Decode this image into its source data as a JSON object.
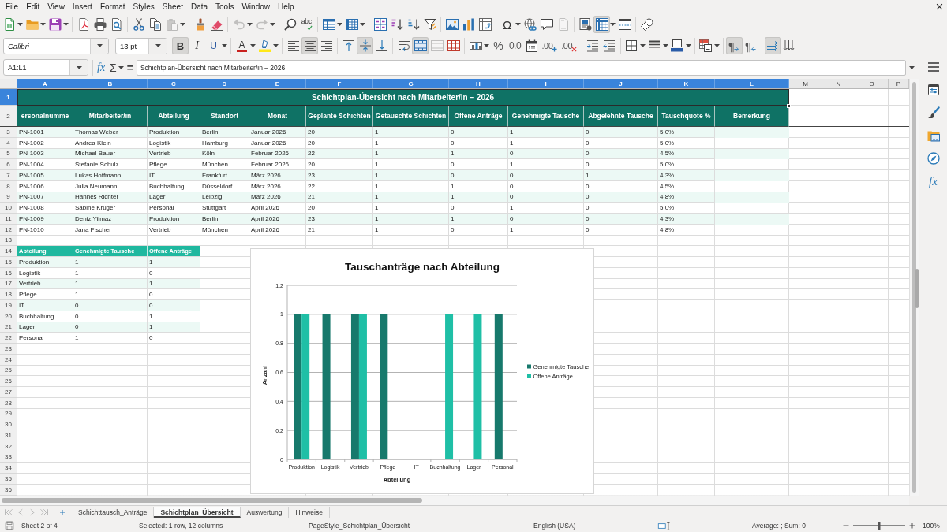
{
  "menu_bar": [
    "File",
    "Edit",
    "View",
    "Insert",
    "Format",
    "Styles",
    "Sheet",
    "Data",
    "Tools",
    "Window",
    "Help"
  ],
  "standard_toolbar": {
    "paste": {
      "disabled": true
    },
    "undo": {
      "disabled": true
    },
    "redo": {
      "disabled": true
    },
    "spelling": {
      "label": "abc"
    },
    "special_character": {
      "label": "Ω"
    },
    "header_footer": {
      "disabled": true
    },
    "freeze": {
      "selected": true
    }
  },
  "formatting_toolbar": {
    "font_name": "Calibri",
    "font_size": "13 pt",
    "bold": {
      "label": "B",
      "selected": true
    },
    "italic": {
      "label": "I",
      "selected": false
    },
    "underline": {
      "label": "U",
      "selected": false
    },
    "font_color": {
      "label": "A"
    },
    "horizontal_align": [
      {
        "selected": false
      },
      {
        "selected": true
      },
      {
        "selected": false
      }
    ],
    "vertical_align": [
      {
        "selected": false
      },
      {
        "selected": true
      },
      {
        "selected": false
      }
    ],
    "merge_and_center": {
      "selected": true
    },
    "merge_cells": {
      "disabled": true
    },
    "percent": {
      "label": "%"
    },
    "number": {
      "label": "0.0"
    },
    "add_decimal": {
      "label": ".00"
    },
    "delete_decimal": {
      "label": ".00"
    },
    "left_to_right": {
      "label": "¶",
      "selected": true
    },
    "right_to_left": {
      "label": "¶",
      "selected": false
    },
    "text_direction": [
      {
        "selected": true
      },
      {
        "selected": false
      }
    ]
  },
  "formula_bar": {
    "name_box": "A1:L1",
    "function_wizard": "fx",
    "sum": "Σ",
    "formula": "=",
    "content": "Schichtplan-Übersicht nach Mitarbeiter/in – 2026"
  },
  "sidebar": {
    "functions": "fx"
  },
  "columns": [
    {
      "label": "A",
      "selected": true
    },
    {
      "label": "B",
      "selected": true
    },
    {
      "label": "C",
      "selected": true
    },
    {
      "label": "D",
      "selected": true
    },
    {
      "label": "E",
      "selected": true
    },
    {
      "label": "F",
      "selected": true
    },
    {
      "label": "G",
      "selected": true
    },
    {
      "label": "H",
      "selected": true
    },
    {
      "label": "I",
      "selected": true
    },
    {
      "label": "J",
      "selected": true
    },
    {
      "label": "K",
      "selected": true
    },
    {
      "label": "L",
      "selected": true
    },
    {
      "label": "M",
      "selected": false
    },
    {
      "label": "N",
      "selected": false
    },
    {
      "label": "O",
      "selected": false
    },
    {
      "label": "P",
      "selected": false
    }
  ],
  "rows": [
    {
      "label": "1",
      "selected": true
    },
    {
      "label": "2",
      "selected": false
    },
    {
      "label": "3",
      "selected": false
    },
    {
      "label": "4",
      "selected": false
    },
    {
      "label": "5",
      "selected": false
    },
    {
      "label": "6",
      "selected": false
    },
    {
      "label": "7",
      "selected": false
    },
    {
      "label": "8",
      "selected": false
    },
    {
      "label": "9",
      "selected": false
    },
    {
      "label": "10",
      "selected": false
    },
    {
      "label": "11",
      "selected": false
    },
    {
      "label": "12",
      "selected": false
    },
    {
      "label": "13",
      "selected": false
    },
    {
      "label": "14",
      "selected": false
    },
    {
      "label": "15",
      "selected": false
    },
    {
      "label": "16",
      "selected": false
    },
    {
      "label": "17",
      "selected": false
    },
    {
      "label": "18",
      "selected": false
    },
    {
      "label": "19",
      "selected": false
    },
    {
      "label": "20",
      "selected": false
    },
    {
      "label": "21",
      "selected": false
    },
    {
      "label": "22",
      "selected": false
    },
    {
      "label": "23",
      "selected": false
    },
    {
      "label": "24",
      "selected": false
    },
    {
      "label": "25",
      "selected": false
    },
    {
      "label": "26",
      "selected": false
    },
    {
      "label": "27",
      "selected": false
    },
    {
      "label": "28",
      "selected": false
    },
    {
      "label": "29",
      "selected": false
    },
    {
      "label": "30",
      "selected": false
    },
    {
      "label": "31",
      "selected": false
    },
    {
      "label": "32",
      "selected": false
    },
    {
      "label": "33",
      "selected": false
    },
    {
      "label": "34",
      "selected": false
    },
    {
      "label": "35",
      "selected": false
    },
    {
      "label": "36",
      "selected": false
    }
  ],
  "title": "Schichtplan-Übersicht nach Mitarbeiter/in – 2026",
  "table": {
    "headers": [
      "ersonalnumme",
      "Mitarbeiter/in",
      "Abteilung",
      "Standort",
      "Monat",
      "Geplante Schichten",
      "Getauschte Schichten",
      "Offene Anträge",
      "Genehmigte Tausche",
      "Abgelehnte Tausche",
      "Tauschquote %",
      "Bemerkung"
    ],
    "rows": [
      [
        "PN-1001",
        "Thomas Weber",
        "Produktion",
        "Berlin",
        "Januar 2026",
        "20",
        "1",
        "0",
        "1",
        "0",
        "5.0%"
      ],
      [
        "PN-1002",
        "Andrea Klein",
        "Logistik",
        "Hamburg",
        "Januar 2026",
        "20",
        "1",
        "0",
        "1",
        "0",
        "5.0%"
      ],
      [
        "PN-1003",
        "Michael Bauer",
        "Vertrieb",
        "Köln",
        "Februar 2026",
        "22",
        "1",
        "1",
        "0",
        "0",
        "4.5%"
      ],
      [
        "PN-1004",
        "Stefanie Schulz",
        "Pflege",
        "München",
        "Februar 2026",
        "20",
        "1",
        "0",
        "1",
        "0",
        "5.0%"
      ],
      [
        "PN-1005",
        "Lukas Hoffmann",
        "IT",
        "Frankfurt",
        "März 2026",
        "23",
        "1",
        "0",
        "0",
        "1",
        "4.3%"
      ],
      [
        "PN-1006",
        "Julia Neumann",
        "Buchhaltung",
        "Düsseldorf",
        "März 2026",
        "22",
        "1",
        "1",
        "0",
        "0",
        "4.5%"
      ],
      [
        "PN-1007",
        "Hannes Richter",
        "Lager",
        "Leipzig",
        "März 2026",
        "21",
        "1",
        "1",
        "0",
        "0",
        "4.8%"
      ],
      [
        "PN-1008",
        "Sabine Krüger",
        "Personal",
        "Stuttgart",
        "April 2026",
        "20",
        "1",
        "0",
        "1",
        "0",
        "5.0%"
      ],
      [
        "PN-1009",
        "Deniz Yilmaz",
        "Produktion",
        "Berlin",
        "April 2026",
        "23",
        "1",
        "1",
        "0",
        "0",
        "4.3%"
      ],
      [
        "PN-1010",
        "Jana Fischer",
        "Vertrieb",
        "München",
        "April 2026",
        "21",
        "1",
        "0",
        "1",
        "0",
        "4.8%"
      ]
    ]
  },
  "summary": {
    "headers": [
      "Abteilung",
      "Genehmigte Tausche",
      "Offene Anträge"
    ],
    "rows": [
      [
        "Produktion",
        "1",
        "1"
      ],
      [
        "Logistik",
        "1",
        "0"
      ],
      [
        "Vertrieb",
        "1",
        "1"
      ],
      [
        "Pflege",
        "1",
        "0"
      ],
      [
        "IT",
        "0",
        "0"
      ],
      [
        "Buchhaltung",
        "0",
        "1"
      ],
      [
        "Lager",
        "0",
        "1"
      ],
      [
        "Personal",
        "1",
        "0"
      ]
    ]
  },
  "chart": {
    "chart_data": {
      "type": "bar",
      "title": "Tauschanträge nach Abteilung",
      "xlabel": "Abteilung",
      "ylabel": "Anzahl",
      "categories": [
        "Produktion",
        "Logistik",
        "Vertrieb",
        "Pflege",
        "IT",
        "Buchhaltung",
        "Lager",
        "Personal"
      ],
      "series": [
        {
          "name": "Genehmigte Tausche",
          "color": "#17796c",
          "values": [
            1,
            1,
            1,
            1,
            0,
            0,
            0,
            1
          ]
        },
        {
          "name": "Offene Anträge",
          "color": "#1fbfa6",
          "values": [
            1,
            0,
            1,
            0,
            0,
            1,
            1,
            0
          ]
        }
      ],
      "ylim": [
        0,
        1.2
      ],
      "yticks": [
        0,
        0.2,
        0.4,
        0.6,
        0.8,
        1,
        1.2
      ],
      "grid": true,
      "legend": true
    }
  },
  "sheet_tabs": [
    {
      "label": "Schichttausch_Anträge",
      "selected": false
    },
    {
      "label": "Schichtplan_Übersicht",
      "selected": true
    },
    {
      "label": "Auswertung",
      "selected": false
    },
    {
      "label": "Hinweise",
      "selected": false
    }
  ],
  "status_bar": {
    "sheet": "Sheet 2 of 4",
    "selection": "Selected: 1 row, 12 columns",
    "page_style": "PageStyle_Schichtplan_Übersicht",
    "language": "English (USA)",
    "statistics": "Average: ; Sum: 0",
    "zoom": {
      "level": 0.5
    },
    "zoom_value": "100%"
  }
}
